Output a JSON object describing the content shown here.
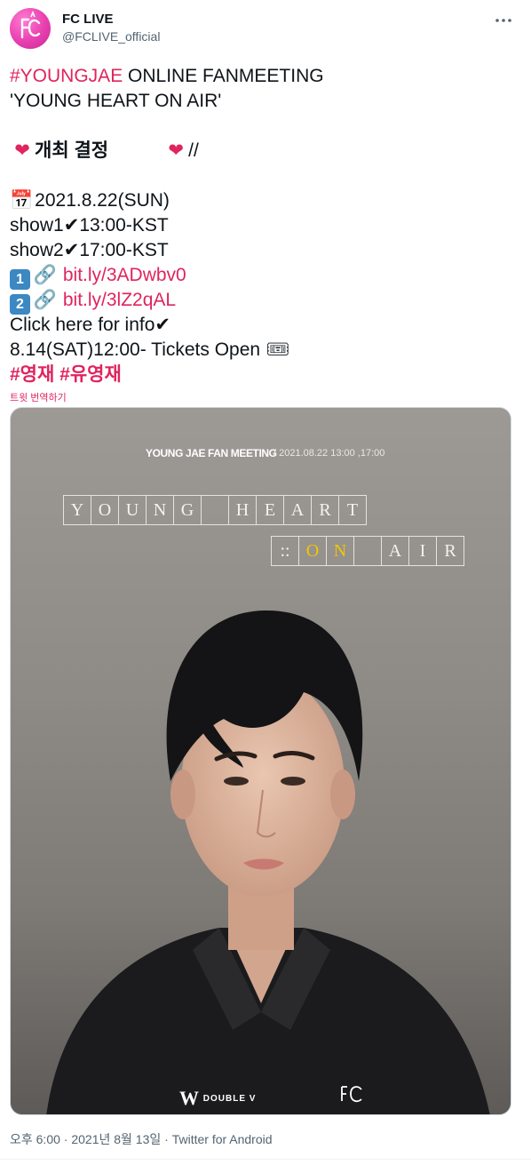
{
  "author": {
    "display_name": "FC LIVE",
    "handle": "@FCLIVE_official",
    "avatar_icon": "fc-live-logo-icon"
  },
  "tweet": {
    "hashtag_youngjae": "#YOUNGJAE",
    "title_rest": " ONLINE FANMEETING",
    "subtitle": "'YOUNG HEART ON AIR'",
    "heart_glyph": "❤",
    "decision_text": "개최 결정",
    "slashes": "//",
    "calendar_glyph": "📅",
    "date": "2021.8.22(SUN)",
    "check_glyph": "✔",
    "show1_label": "show1",
    "show1_time": "13:00-KST",
    "show2_label": "show2",
    "show2_time": "17:00-KST",
    "keycap1": "1",
    "keycap2": "2",
    "link_glyph": "🔗",
    "link1": "bit.ly/3ADwbv0",
    "link2": "bit.ly/3lZ2qAL",
    "info_text": "Click here for info",
    "tickets_text": "8.14(SAT)12:00- Tickets Open",
    "ticket_glyph": "🎟",
    "hashtag_ko1": "#영재",
    "hashtag_ko2": "#유영재",
    "translate_label": "트윗 번역하기"
  },
  "poster": {
    "title": "YOUNG JAE FAN MEETING",
    "date_line": "/  2021.08.22 13:00 ,17:00",
    "row1": [
      "Y",
      "O",
      "U",
      "N",
      "G",
      "",
      "H",
      "E",
      "A",
      "R",
      "T"
    ],
    "row2": [
      "::",
      "O",
      "N",
      "",
      "A",
      "I",
      "R"
    ],
    "row2_highlight": [
      "O",
      "N"
    ],
    "brand_left": "DOUBLE V",
    "accent_color": "#f2c600"
  },
  "meta": {
    "timestamp": "오후 6:00 · 2021년 8월 13일 · Twitter for Android"
  },
  "colors": {
    "link": "#e0245e",
    "text": "#0f1419",
    "muted": "#536471"
  }
}
